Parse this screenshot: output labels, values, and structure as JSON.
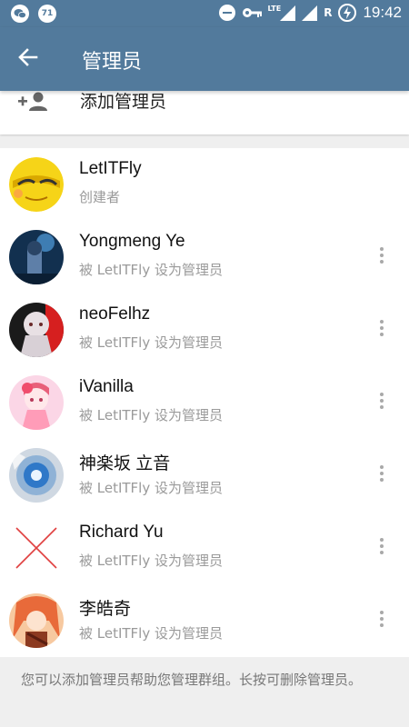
{
  "status_bar": {
    "time": "19:42",
    "badge": "71",
    "network": "LTE",
    "roaming": "R",
    "left_icons": [
      "wechat-icon",
      "notification-71-icon"
    ],
    "right_icons": [
      "do-not-disturb-icon",
      "key-icon",
      "lte-signal-icon",
      "signal-icon",
      "battery-charging-icon"
    ]
  },
  "appbar": {
    "title": "管理员",
    "back_icon": "arrow-back-icon",
    "background": "#527a9c"
  },
  "add_admin": {
    "label": "添加管理员",
    "icon": "add-person-icon"
  },
  "admins": [
    {
      "name": "LetITFly",
      "subtitle": "创建者",
      "avatar": "emoji-face-avatar",
      "has_menu": false
    },
    {
      "name": "Yongmeng Ye",
      "subtitle": "被 LetITFly 设为管理员",
      "avatar": "anime-night-avatar",
      "has_menu": true
    },
    {
      "name": "neoFelhz",
      "subtitle": "被 LetITFly 设为管理员",
      "avatar": "anime-girl-red-avatar",
      "has_menu": true
    },
    {
      "name": "iVanilla",
      "subtitle": "被 LetITFly 设为管理员",
      "avatar": "anime-pink-avatar",
      "has_menu": true
    },
    {
      "name": "神楽坂 立音",
      "subtitle": "被 LetITFly 设为管理员",
      "avatar": "blue-eye-avatar",
      "has_menu": true
    },
    {
      "name": "Richard Yu",
      "subtitle": "被 LetITFly 设为管理员",
      "avatar": "red-cross-avatar",
      "has_menu": true
    },
    {
      "name": "李皓奇",
      "subtitle": "被 LetITFly 设为管理员",
      "avatar": "anime-orange-avatar",
      "has_menu": true
    }
  ],
  "footer": {
    "text": "您可以添加管理员帮助您管理群组。长按可删除管理员。"
  }
}
